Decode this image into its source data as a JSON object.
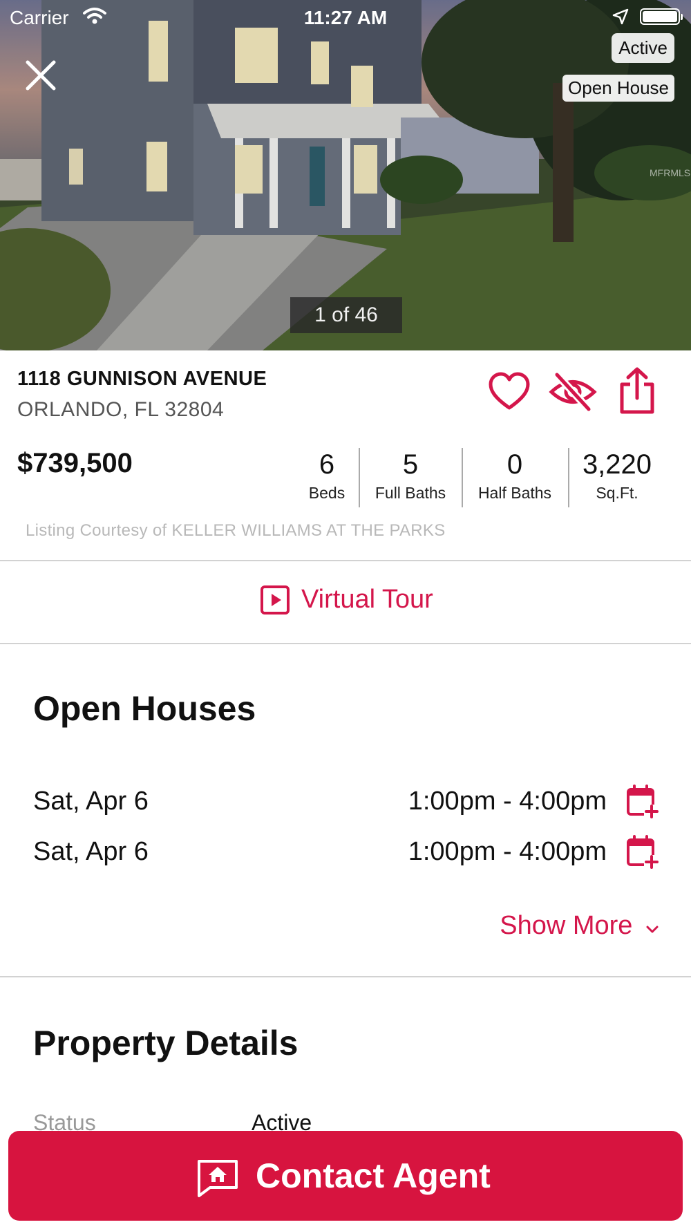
{
  "status_bar": {
    "carrier": "Carrier",
    "time": "11:27 AM"
  },
  "hero": {
    "badges": {
      "status": "Active",
      "event": "Open House"
    },
    "photo_counter": "1 of 46",
    "watermark": "MFRMLS"
  },
  "listing": {
    "street": "1118 GUNNISON AVENUE",
    "city_line": "ORLANDO, FL 32804",
    "price": "$739,500",
    "stats": [
      {
        "value": "6",
        "label": "Beds"
      },
      {
        "value": "5",
        "label": "Full Baths"
      },
      {
        "value": "0",
        "label": "Half Baths"
      },
      {
        "value": "3,220",
        "label": "Sq.Ft."
      }
    ],
    "courtesy": "Listing Courtesy of KELLER WILLIAMS AT THE PARKS"
  },
  "virtual_tour": {
    "label": "Virtual Tour"
  },
  "open_houses": {
    "title": "Open Houses",
    "items": [
      {
        "date": "Sat, Apr 6",
        "time": "1:00pm - 4:00pm"
      },
      {
        "date": "Sat, Apr 6",
        "time": "1:00pm - 4:00pm"
      }
    ],
    "show_more": "Show More"
  },
  "property_details": {
    "title": "Property Details",
    "rows": [
      {
        "label": "Status",
        "value": "Active"
      }
    ]
  },
  "contact": {
    "label": "Contact Agent"
  },
  "icons": {
    "close": "close-icon",
    "favorite": "heart-icon",
    "hide": "eye-slash-icon",
    "share": "share-icon",
    "tour": "play-square-icon",
    "calendar_add": "calendar-plus-icon",
    "chevron": "chevron-down-icon",
    "contact": "message-house-icon"
  },
  "colors": {
    "accent": "#d7143f",
    "text_primary": "#111111",
    "text_muted": "#b8b8b8"
  }
}
